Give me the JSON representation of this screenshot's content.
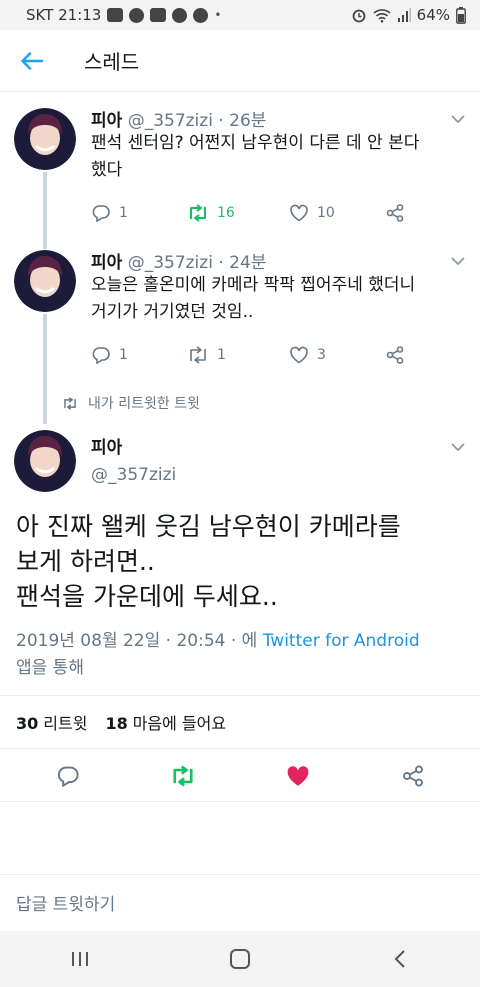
{
  "status_bar": {
    "carrier_time": "SKT 21:13",
    "battery": "64%"
  },
  "header": {
    "title": "스레드"
  },
  "thread": [
    {
      "name": "피아",
      "handle_time": "@_357zizi · 26분",
      "text_line1": "팬석 센터임? 어쩐지 남우현이 다른 데 안 본다",
      "text_line2": "했다",
      "replies": "1",
      "retweets": "16",
      "likes": "10",
      "retweeted_by_me": true
    },
    {
      "name": "피아",
      "handle_time": "@_357zizi · 24분",
      "text_line1": "오늘은 홀온미에 카메라 팍팍 찝어주네 했더니",
      "text_line2": "거기가 거기였던 것임..",
      "replies": "1",
      "retweets": "1",
      "likes": "3",
      "retweeted_by_me": false
    }
  ],
  "retweet_note": "내가 리트윗한 트윗",
  "main_tweet": {
    "name": "피아",
    "handle": "@_357zizi",
    "text_line1": "아 진짜 왤케 웃김 남우현이 카메라를",
    "text_line2": "보게 하려면..",
    "text_line3": "팬석을 가운데에 두세요..",
    "timestamp": "2019년 08월 22일 · 20:54 · 에",
    "via_app": "Twitter for Android",
    "via_suffix": "앱을 통해",
    "retweet_count": "30",
    "retweet_label": "리트윗",
    "like_count": "18",
    "like_label": "마음에 들어요"
  },
  "reply_placeholder": "답글 트윗하기",
  "colors": {
    "accent": "#1da1f2",
    "retweet": "#17bf63",
    "like": "#e0245e",
    "muted": "#657786"
  },
  "icons": [
    "back-arrow-icon",
    "chevron-down-icon",
    "reply-icon",
    "retweet-icon",
    "like-icon",
    "share-icon",
    "recents-icon",
    "home-icon",
    "back-nav-icon"
  ]
}
